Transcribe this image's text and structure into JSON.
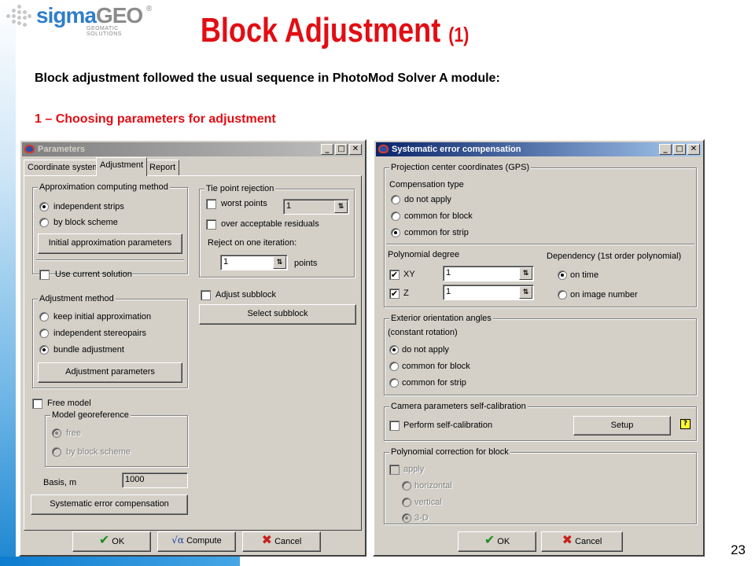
{
  "slide": {
    "logo_text_1": "sigma",
    "logo_text_2": "GEO",
    "logo_reg": "®",
    "logo_sub": "GEOMATIC SOLUTIONS",
    "title": "Block Adjustment",
    "title_suffix": "(1)",
    "intro": "Block adjustment followed the usual sequence in PhotoMod Solver A module:",
    "step": "1 – Choosing parameters for adjustment",
    "page_number": "23"
  },
  "colors": {
    "accent_red": "#e10e14",
    "title_bar": "#0a246a",
    "dialog_face": "#d4d0c8"
  },
  "parameters_dialog": {
    "title": "Parameters",
    "tabs": [
      {
        "label": "Coordinate system",
        "active": false
      },
      {
        "label": "Adjustment",
        "active": true
      },
      {
        "label": "Report",
        "active": false
      }
    ],
    "approx_group": {
      "title": "Approximation computing method",
      "options": [
        "independent strips",
        "by block scheme"
      ],
      "selected": 0,
      "initial_button": "Initial approximation parameters",
      "use_current": "Use current solution"
    },
    "adjustment_group": {
      "title": "Adjustment method",
      "options": [
        "keep initial approximation",
        "independent stereopairs",
        "bundle adjustment"
      ],
      "selected": 2,
      "params_button": "Adjustment parameters"
    },
    "free_model": "Free model",
    "georef_group": {
      "title": "Model georeference",
      "options": [
        "free",
        "by block scheme"
      ],
      "selected": 0
    },
    "basis": {
      "label": "Basis, m",
      "value": "1000"
    },
    "sec_button": "Systematic error compensation",
    "tie_group": {
      "title": "Tie point rejection",
      "worst_points": "worst points",
      "worst_value": "1",
      "over_residuals": "over acceptable residuals",
      "reject_label": "Reject on one iteration:",
      "reject_value": "1",
      "points_label": "points"
    },
    "adjust_subblock": "Adjust subblock",
    "select_subblock": "Select subblock",
    "ok": "OK",
    "compute": "Compute",
    "cancel": "Cancel"
  },
  "sec_dialog": {
    "title": "Systematic error compensation",
    "gps_group": {
      "title": "Projection center coordinates (GPS)",
      "comp_type": "Compensation type",
      "options": [
        "do not apply",
        "common for block",
        "common for strip"
      ],
      "selected": 2,
      "poly_degree": "Polynomial degree",
      "xy_label": "XY",
      "xy_value": "1",
      "z_label": "Z",
      "z_value": "1",
      "dependency": "Dependency (1st order polynomial)",
      "dep_options": [
        "on time",
        "on image number"
      ],
      "dep_selected": 0
    },
    "eo_group": {
      "title": "Exterior orientation angles",
      "subtitle": "(constant rotation)",
      "options": [
        "do not apply",
        "common for block",
        "common for strip"
      ],
      "selected": 0
    },
    "cam_group": {
      "title": "Camera parameters self-calibration",
      "perform": "Perform self-calibration",
      "setup": "Setup",
      "help": "?"
    },
    "poly_group": {
      "title": "Polynomial correction for block",
      "apply": "apply",
      "options": [
        "horizontal",
        "vertical",
        "3-D"
      ],
      "selected": 2
    },
    "ok": "OK",
    "cancel": "Cancel"
  }
}
